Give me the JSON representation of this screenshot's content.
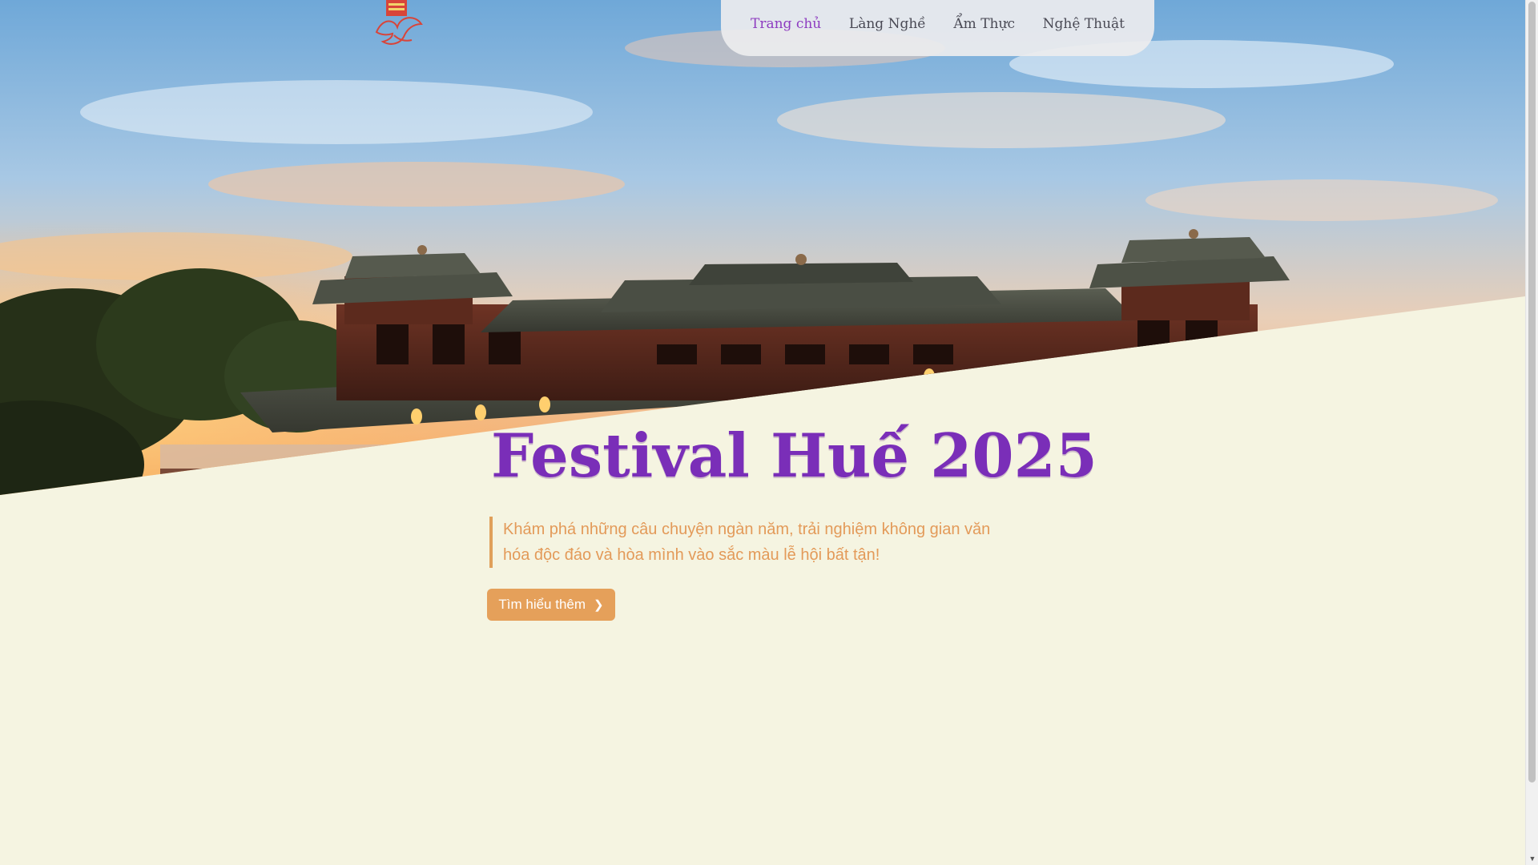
{
  "nav": {
    "items": [
      {
        "label": "Trang chủ",
        "active": true
      },
      {
        "label": "Làng Nghề",
        "active": false
      },
      {
        "label": "Ẩm Thực",
        "active": false
      },
      {
        "label": "Nghệ Thuật",
        "active": false
      }
    ]
  },
  "hero": {
    "title": "Festival Huế 2025",
    "description": "Khám phá những câu chuyện ngàn năm, trải nghiệm không gian văn hóa độc đáo và hòa mình vào sắc màu lễ hội bất tận!",
    "cta_label": "Tìm hiểu thêm",
    "cta_icon": "chevron-right-icon"
  },
  "colors": {
    "accent_purple": "#7a2eb8",
    "nav_active": "#8e3cc0",
    "accent_orange": "#e5a05a",
    "page_background": "#f5f4e1"
  },
  "icons": {
    "logo": "phoenix-emblem-icon",
    "scroll_up": "arrow-up-icon",
    "scroll_down": "arrow-down-icon"
  }
}
